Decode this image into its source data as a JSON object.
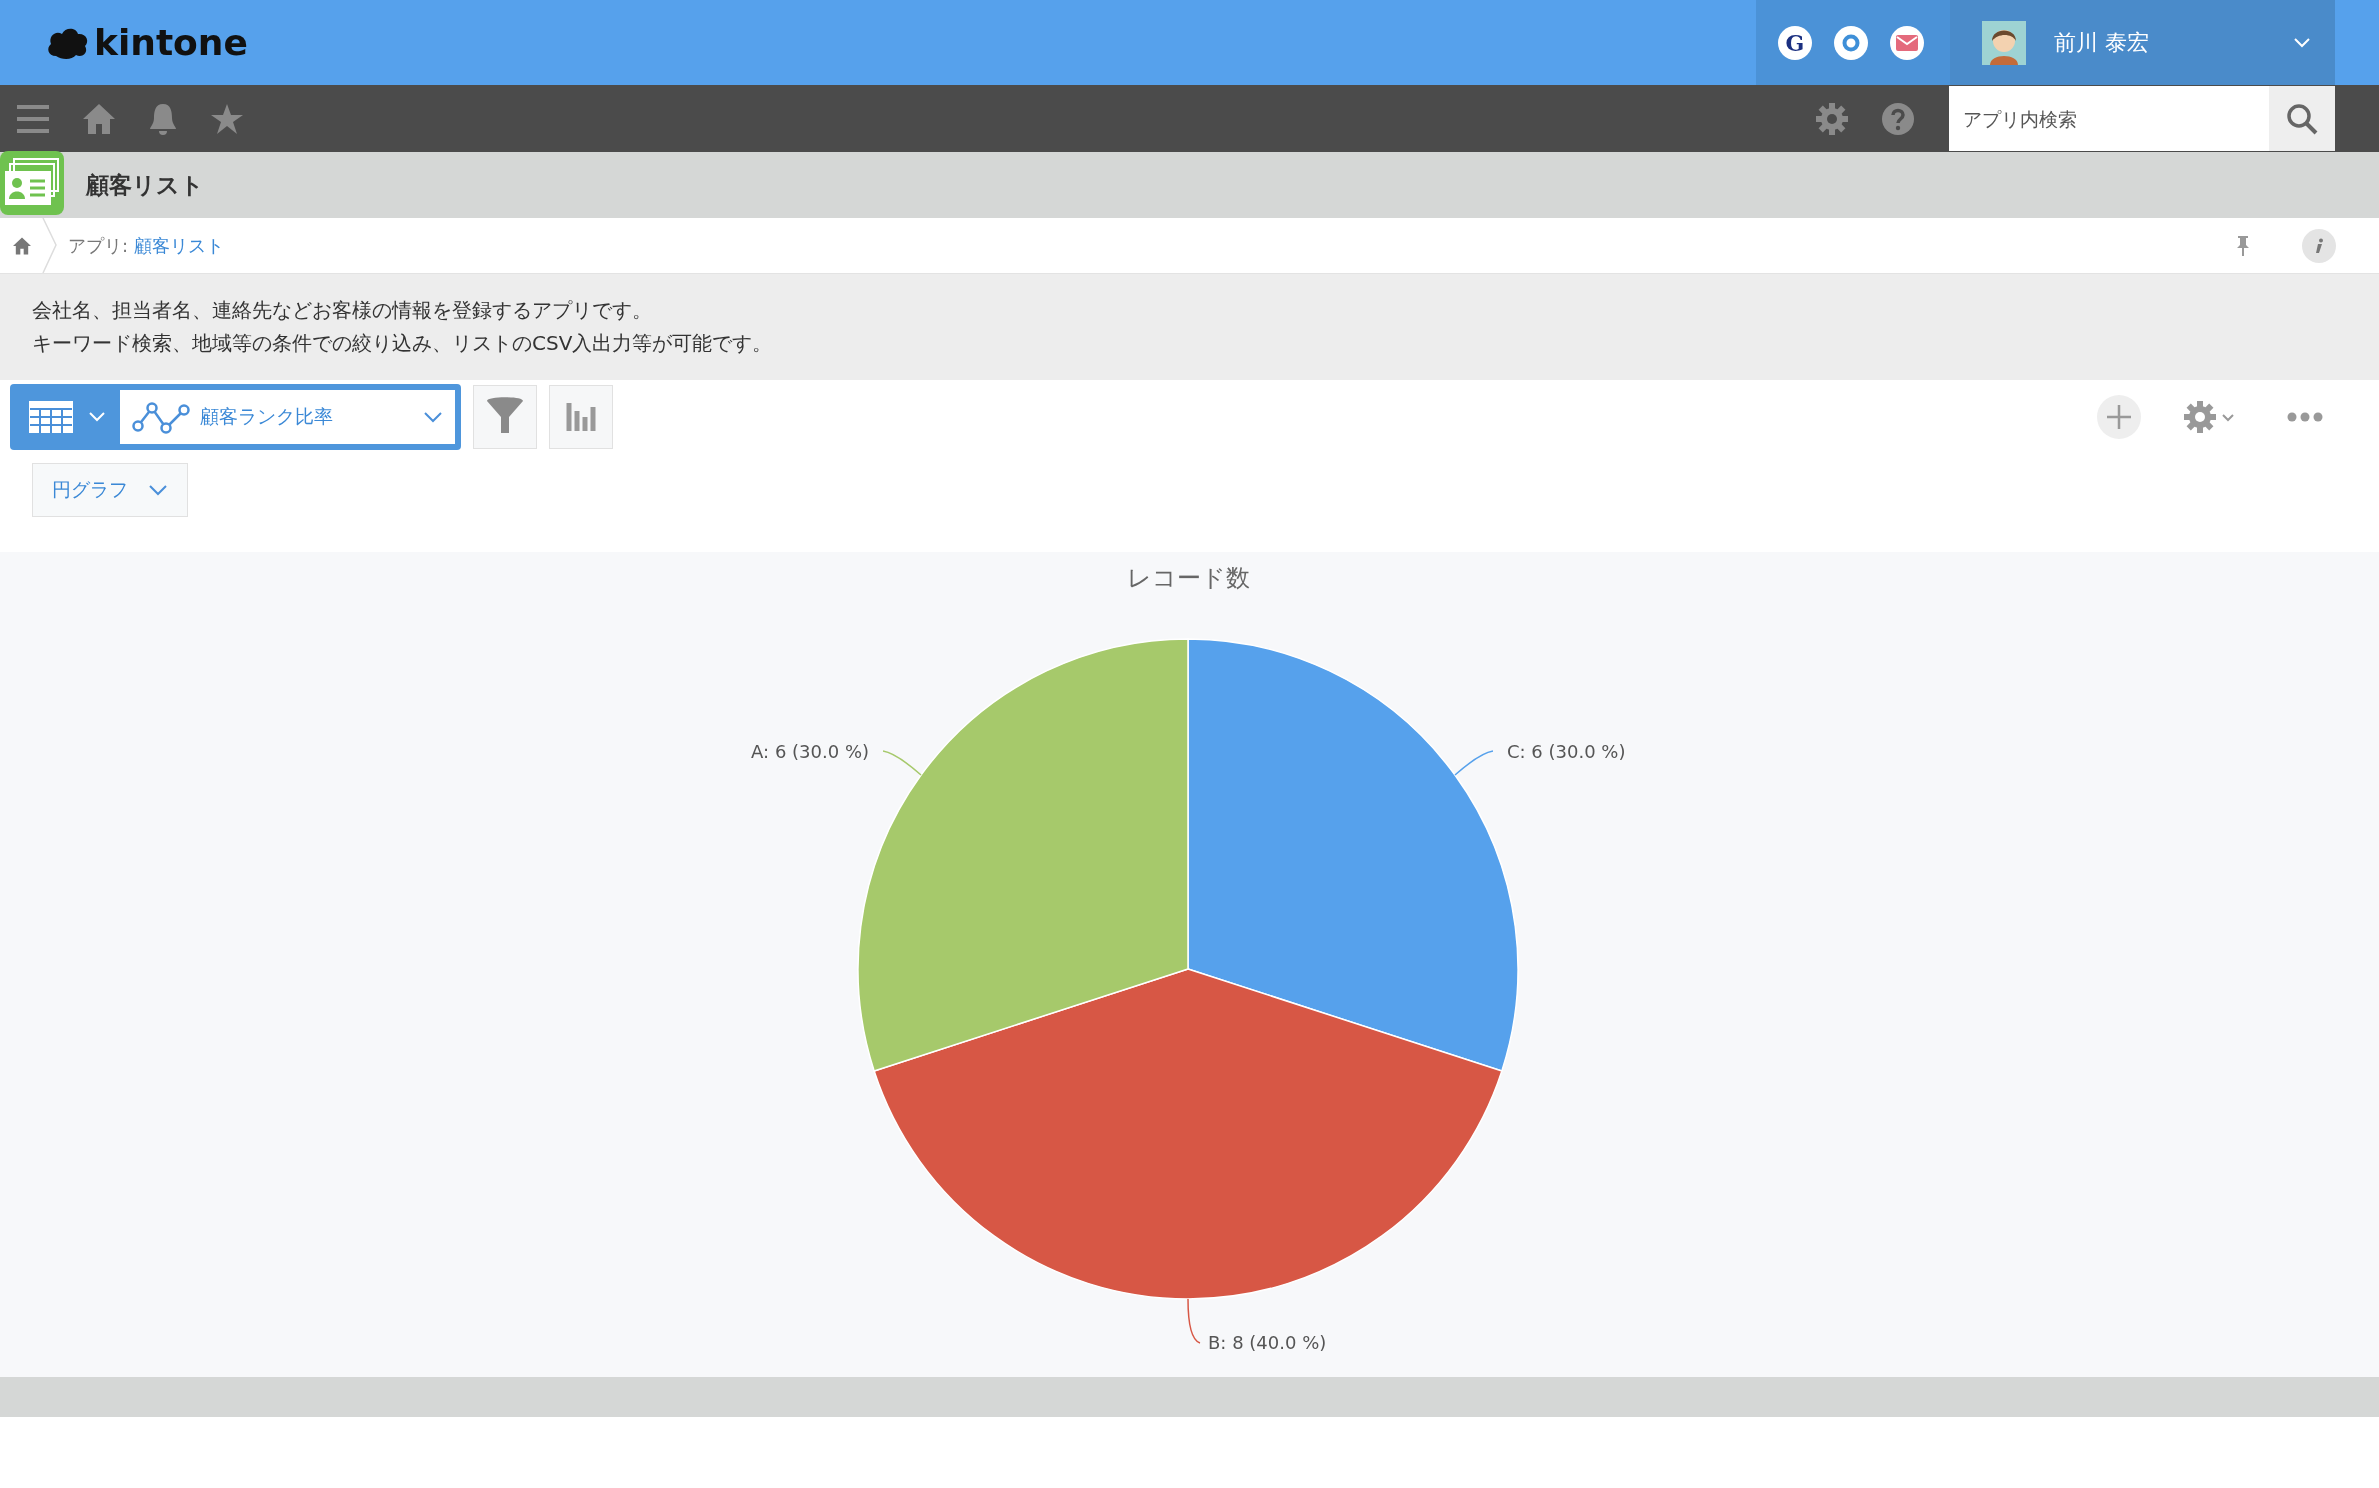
{
  "header": {
    "logo": "kintone",
    "app_icons": [
      {
        "kind": "letter",
        "glyph": "G"
      },
      {
        "kind": "ring"
      },
      {
        "kind": "mail"
      }
    ],
    "user_name": "前川 泰宏"
  },
  "search": {
    "placeholder": "アプリ内検索"
  },
  "app": {
    "title": "顧客リスト"
  },
  "breadcrumb": {
    "prefix": "アプリ:",
    "link": "顧客リスト"
  },
  "description": [
    "会社名、担当者名、連絡先などお客様の情報を登録するアプリです。",
    "キーワード検索、地域等の条件での絞り込み、リストのCSV入出力等が可能です。"
  ],
  "view_selector": {
    "label": "顧客ランク比率"
  },
  "chart_type": {
    "label": "円グラフ"
  },
  "chart": {
    "chart_data": {
      "type": "pie",
      "title": "レコード数",
      "values": [
        6,
        8,
        6
      ],
      "colors": [
        "#56a1ec",
        "#d75745",
        "#a6c96b"
      ],
      "value_labels": [
        "C: 6 (30.0 %)",
        "B: 8 (40.0 %)",
        "A: 6 (30.0 %)"
      ]
    }
  }
}
